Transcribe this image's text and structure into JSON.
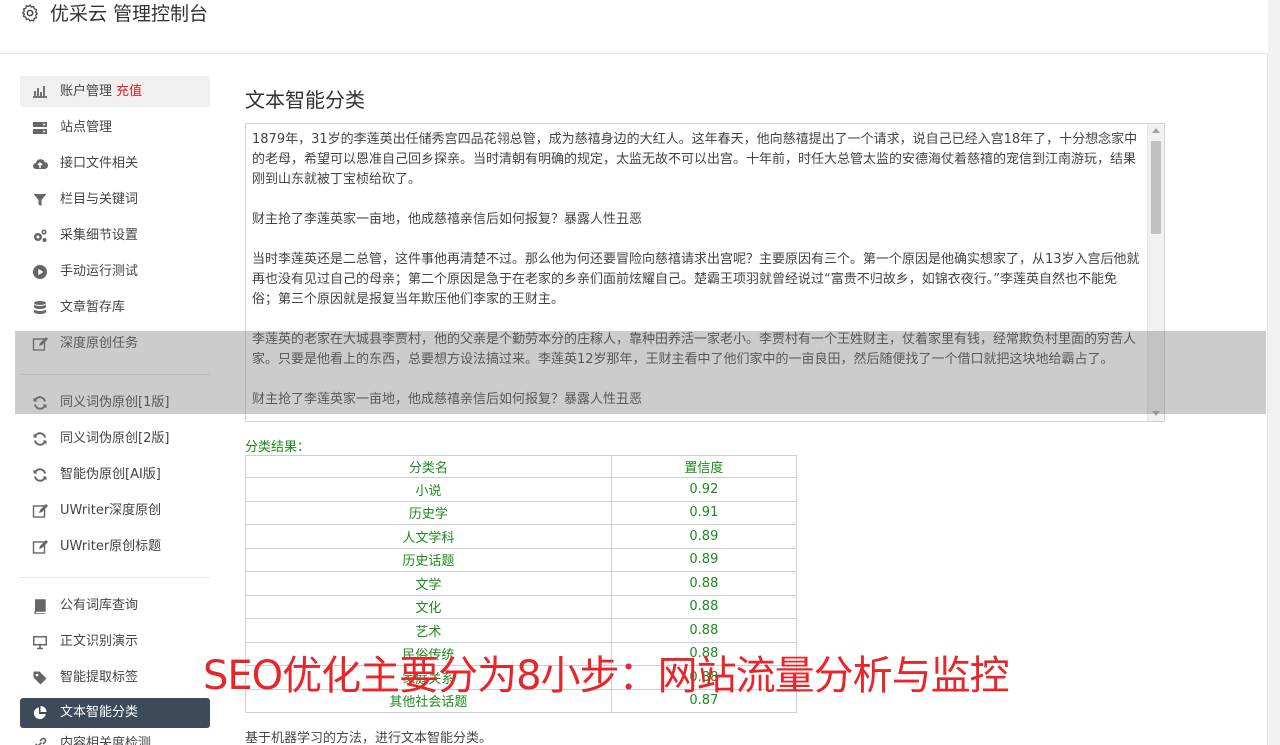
{
  "header": {
    "icon": "gear-icon",
    "title": "优采云 管理控制台"
  },
  "sidebar": {
    "groups": [
      {
        "items": [
          {
            "icon": "bar-chart-icon",
            "label": "账户管理",
            "extra": "充值"
          },
          {
            "icon": "server-icon",
            "label": "站点管理"
          },
          {
            "icon": "cloud-upload-icon",
            "label": "接口文件相关"
          },
          {
            "icon": "filter-icon",
            "label": "栏目与关键词"
          },
          {
            "icon": "cogs-icon",
            "label": "采集细节设置"
          },
          {
            "icon": "play-circle-icon",
            "label": "手动运行测试"
          },
          {
            "icon": "database-icon",
            "label": "文章暂存库"
          },
          {
            "icon": "edit-icon",
            "label": "深度原创任务"
          }
        ]
      },
      {
        "items": [
          {
            "icon": "refresh-icon",
            "label": "同义词伪原创[1版]"
          },
          {
            "icon": "refresh-icon",
            "label": "同义词伪原创[2版]"
          },
          {
            "icon": "refresh-icon",
            "label": "智能伪原创[AI版]"
          },
          {
            "icon": "edit-icon",
            "label": "UWriter深度原创"
          },
          {
            "icon": "edit-icon",
            "label": "UWriter原创标题"
          }
        ]
      },
      {
        "items": [
          {
            "icon": "book-icon",
            "label": "公有词库查询"
          },
          {
            "icon": "monitor-icon",
            "label": "正文识别演示"
          },
          {
            "icon": "tag-icon",
            "label": "智能提取标签"
          },
          {
            "icon": "pie-chart-icon",
            "label": "文本智能分类",
            "active": true
          },
          {
            "icon": "link-icon",
            "label": "内容相关度检测"
          }
        ]
      }
    ]
  },
  "main": {
    "title": "文本智能分类",
    "text_content": [
      "1879年，31岁的李莲英出任储秀宫四品花翎总管，成为慈禧身边的大红人。这年春天，他向慈禧提出了一个请求，说自己已经入宫18年了，十分想念家中的老母，希望可以恩准自己回乡探亲。当时清朝有明确的规定，太监无故不可以出宫。十年前，时任大总管太监的安德海仗着慈禧的宠信到江南游玩，结果刚到山东就被丁宝桢给砍了。",
      "财主抢了李莲英家一亩地，他成慈禧亲信后如何报复？暴露人性丑恶",
      "当时李莲英还是二总管，这件事他再清楚不过。那么他为何还要冒险向慈禧请求出宫呢？主要原因有三个。第一个原因是他确实想家了，从13岁入宫后他就再也没有见过自己的母亲；第二个原因是急于在老家的乡亲们面前炫耀自己。楚霸王项羽就曾经说过“富贵不归故乡，如锦衣夜行。”李莲英自然也不能免俗；第三个原因就是报复当年欺压他们李家的王财主。",
      "李莲英的老家在大城县李贾村，他的父亲是个勤劳本分的庄稼人，靠种田养活一家老小。李贾村有一个王姓财主，仗着家里有钱，经常欺负村里面的穷苦人家。只要是他看上的东西，总要想方设法搞过来。李莲英12岁那年，王财主看中了他们家中的一亩良田，然后随便找了一个借口就把这块地给霸占了。",
      "财主抢了李莲英家一亩地，他成慈禧亲信后如何报复？暴露人性丑恶"
    ],
    "result_label": "分类结果：",
    "table": {
      "headers": [
        "分类名",
        "置信度"
      ],
      "rows": [
        [
          "小说",
          "0.92"
        ],
        [
          "历史学",
          "0.91"
        ],
        [
          "人文学科",
          "0.89"
        ],
        [
          "历史话题",
          "0.89"
        ],
        [
          "文学",
          "0.88"
        ],
        [
          "文化",
          "0.88"
        ],
        [
          "艺术",
          "0.88"
        ],
        [
          "民俗传统",
          "0.88"
        ],
        [
          "家庭关系",
          "0.88"
        ],
        [
          "其他社会话题",
          "0.87"
        ]
      ]
    },
    "footer_note": "基于机器学习的方法，进行文本智能分类。"
  },
  "banner": {
    "text": "SEO优化主要分为8小步：网站流量分析与监控"
  },
  "colors": {
    "accent_green": "#1a8a1a",
    "recharge_red": "#e02020",
    "active_nav_bg": "#3d4a5a",
    "banner_red": "#e8252a"
  }
}
